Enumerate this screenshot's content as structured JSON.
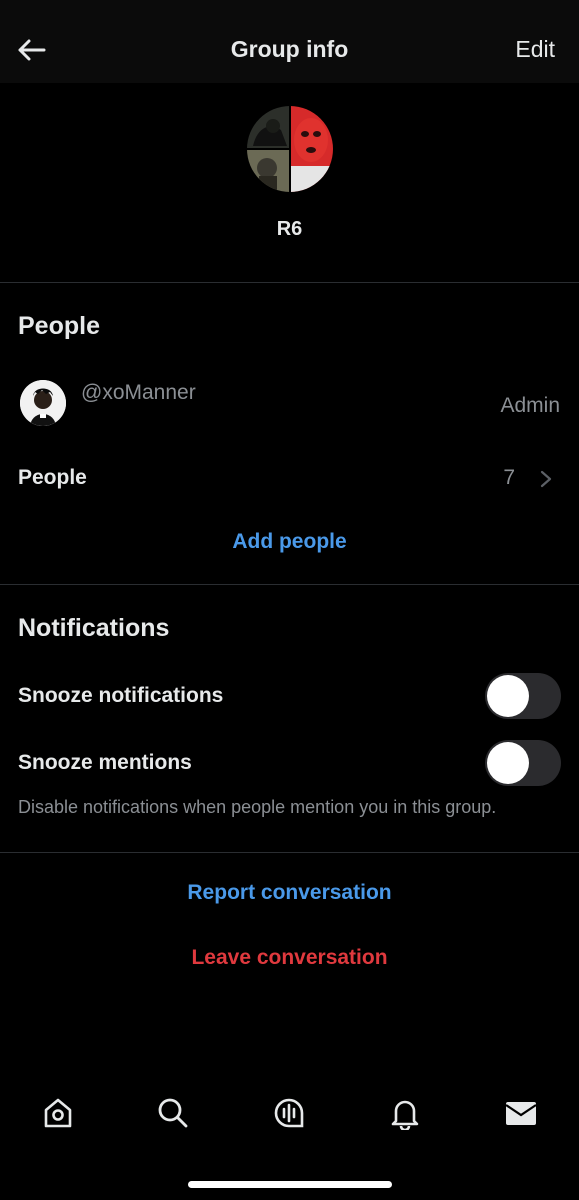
{
  "header": {
    "title": "Group info",
    "edit_label": "Edit",
    "back_icon": "arrow-left-icon"
  },
  "group": {
    "name": "R6"
  },
  "people_section": {
    "title": "People",
    "member": {
      "handle": "@xoManner",
      "role": "Admin"
    },
    "people_row": {
      "label": "People",
      "count": "7"
    },
    "add_people_label": "Add people"
  },
  "notifications_section": {
    "title": "Notifications",
    "snooze_notifications": {
      "label": "Snooze notifications",
      "enabled": false
    },
    "snooze_mentions": {
      "label": "Snooze mentions",
      "enabled": false
    },
    "hint": "Disable notifications when people mention you in this group."
  },
  "actions": {
    "report_label": "Report conversation",
    "leave_label": "Leave conversation"
  },
  "tabbar": {
    "items": [
      {
        "icon": "home-icon"
      },
      {
        "icon": "search-icon"
      },
      {
        "icon": "spaces-icon"
      },
      {
        "icon": "bell-icon"
      },
      {
        "icon": "mail-icon"
      }
    ]
  },
  "colors": {
    "background": "#000000",
    "link_blue": "#4a99e9",
    "danger_red": "#e0393e",
    "secondary_text": "#8b8f94"
  }
}
